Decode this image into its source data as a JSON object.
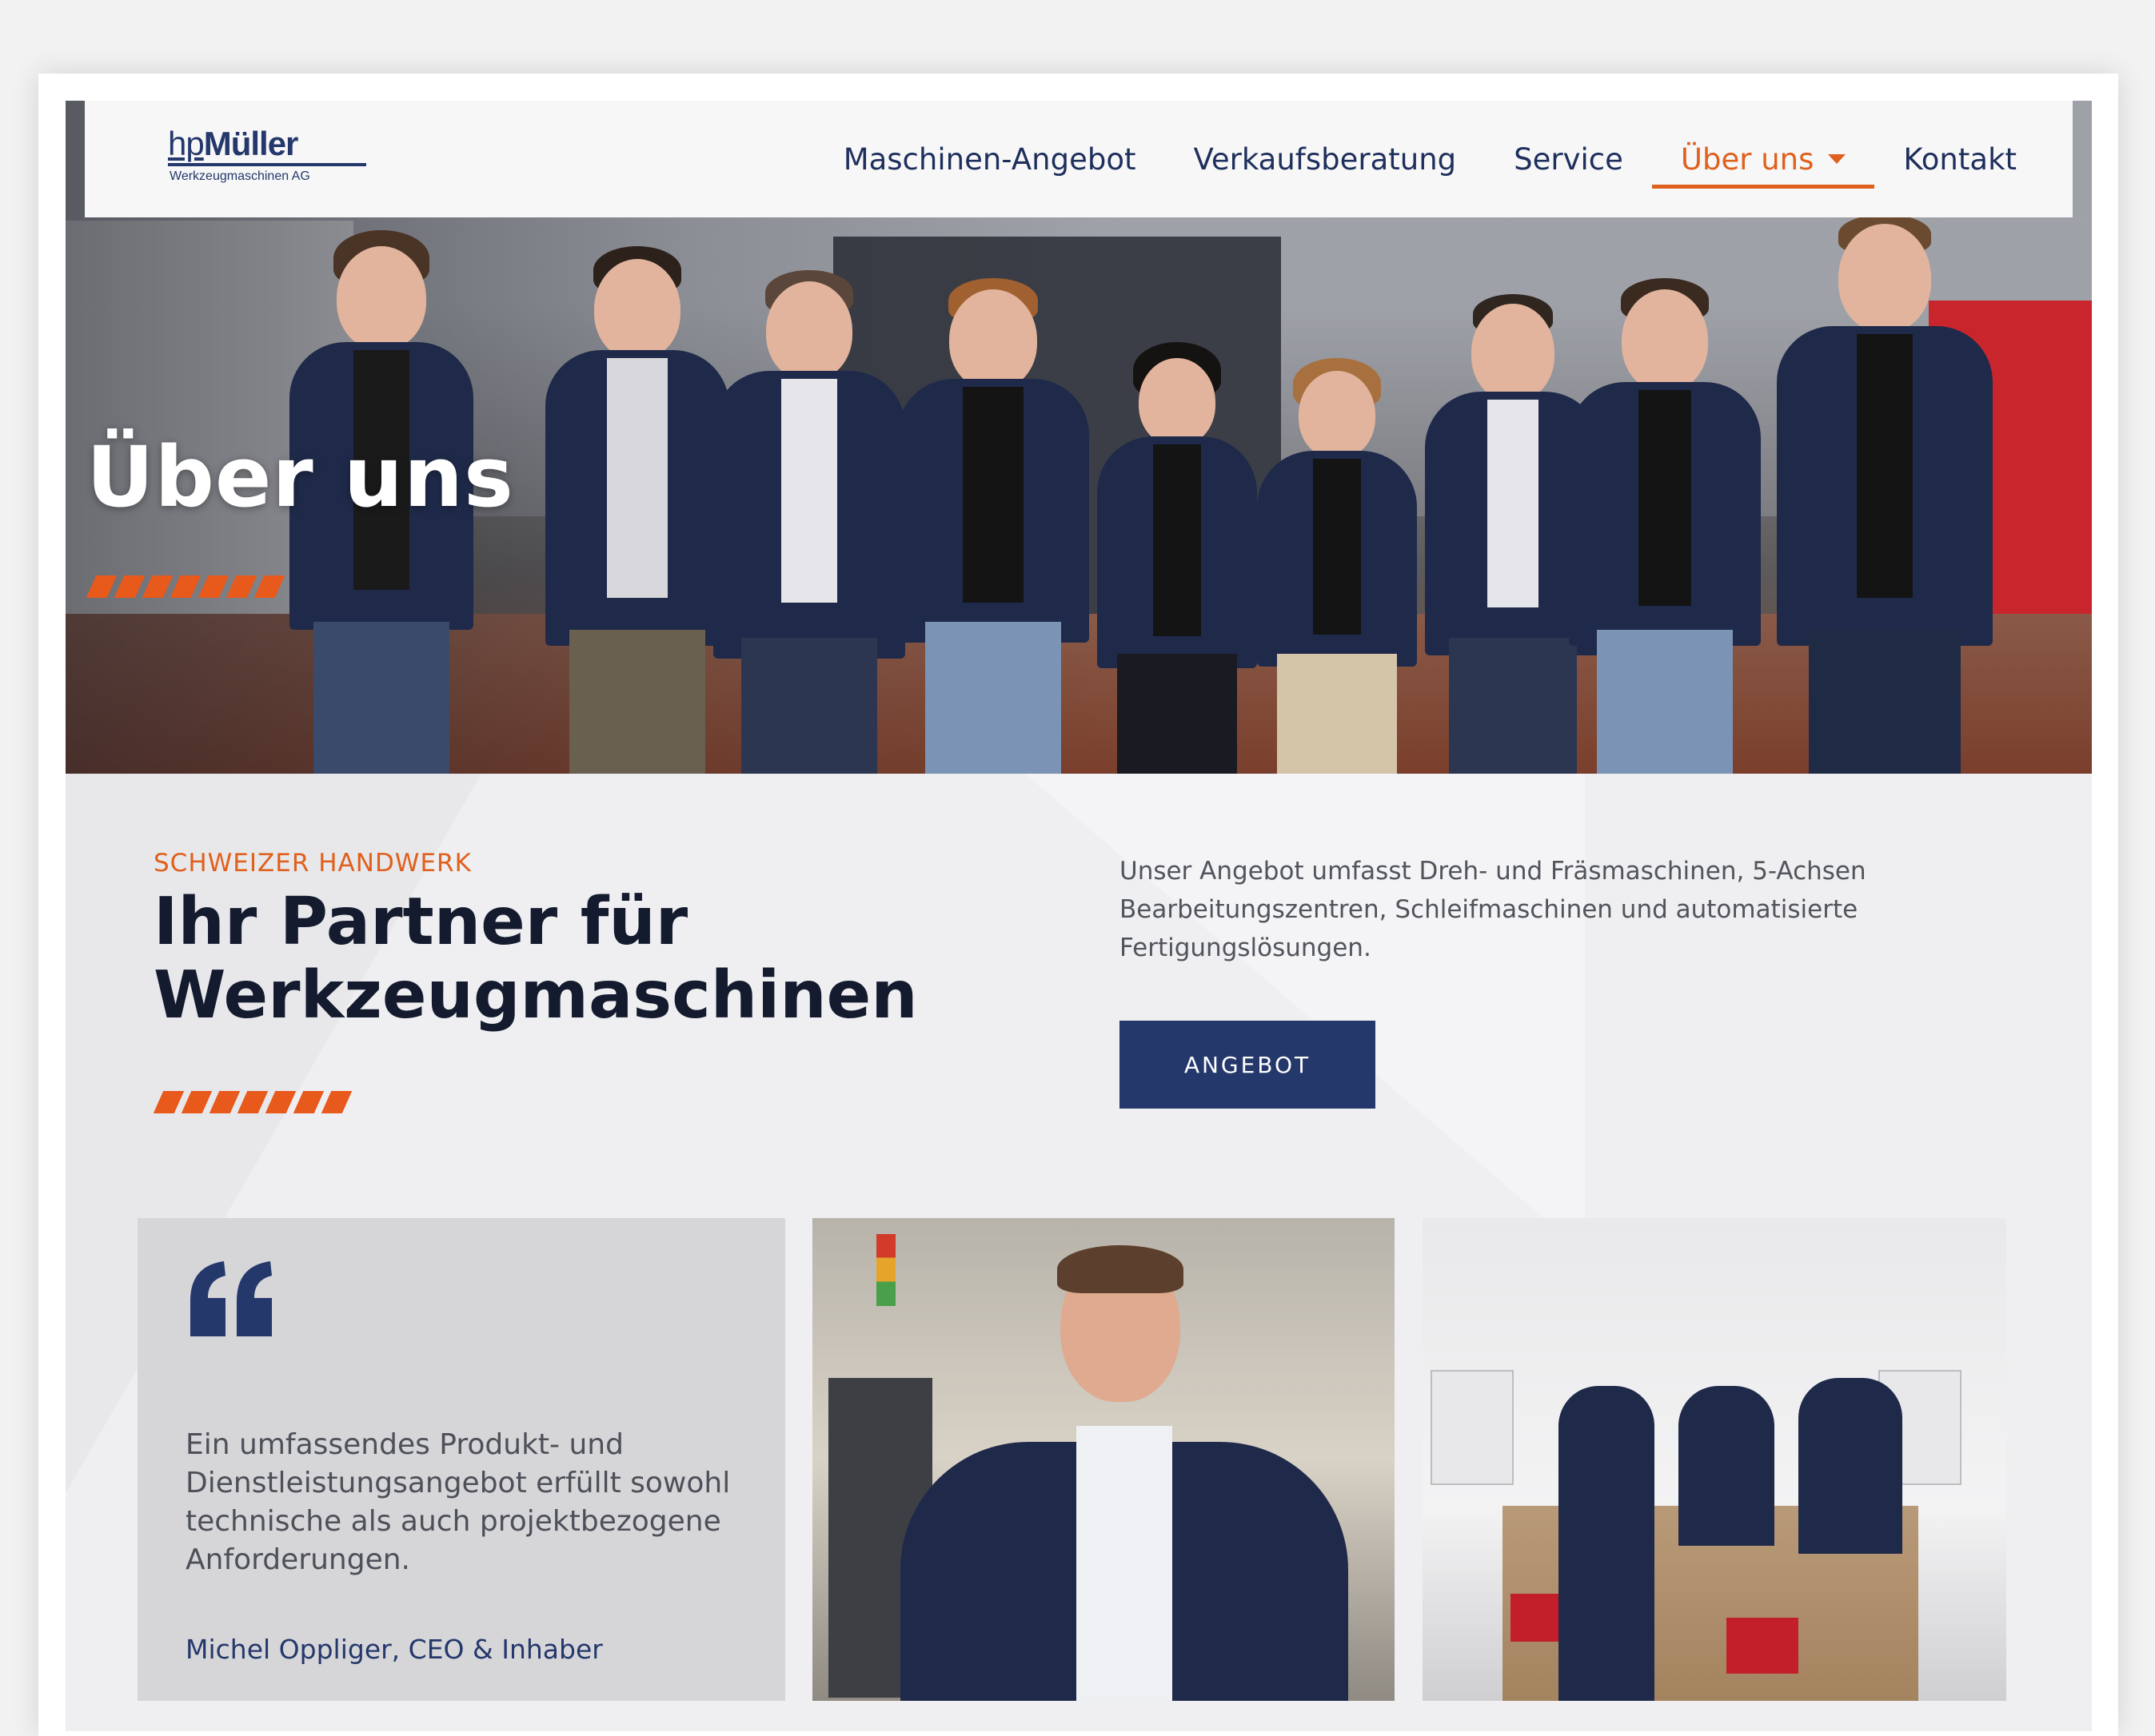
{
  "logo": {
    "hp": "hp",
    "name": "Müller",
    "subtitle": "Werkzeugmaschinen AG"
  },
  "nav": {
    "items": [
      {
        "label": "Maschinen-Angebot"
      },
      {
        "label": "Verkaufsberatung"
      },
      {
        "label": "Service"
      },
      {
        "label": "Über uns",
        "active": true,
        "has_dropdown": true
      },
      {
        "label": "Kontakt"
      }
    ]
  },
  "hero": {
    "title": "Über uns"
  },
  "intro": {
    "eyebrow": "SCHWEIZER HANDWERK",
    "headline": "Ihr Partner für Werkzeugmaschinen",
    "text": "Unser Angebot umfasst Dreh- und Fräsmaschinen, 5-Achsen Bearbeitungszentren, Schleifmaschinen und automatisierte Fertigungslösungen.",
    "button_label": "ANGEBOT"
  },
  "quote": {
    "icon": "quote-icon",
    "text": "Ein umfassendes Produkt- und Dienstleistungsangebot erfüllt sowohl technische als auch projektbezogene Anforderungen.",
    "author": "Michel Oppliger, CEO & Inhaber"
  },
  "colors": {
    "brand_blue": "#24386b",
    "accent_orange": "#e0601d",
    "headline": "#141b2f"
  }
}
